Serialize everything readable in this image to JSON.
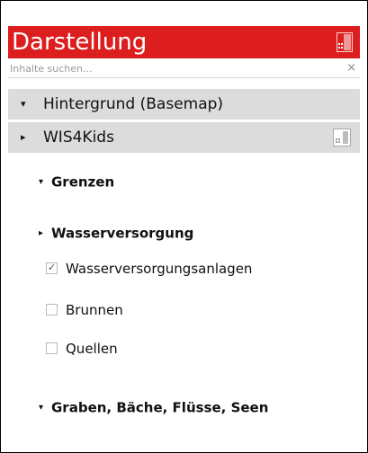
{
  "panel": {
    "title": "Darstellung",
    "accent_color": "#dc1e1e",
    "header_icon": "legend-icon"
  },
  "search": {
    "placeholder": "Inhalte suchen...",
    "value": "",
    "clear_label": "×"
  },
  "groups": [
    {
      "label": "Hintergrund (Basemap)",
      "expanded": true
    },
    {
      "label": "WIS4Kids",
      "expanded": false,
      "icon": "legend-icon"
    }
  ],
  "subgroups": [
    {
      "label": "Grenzen",
      "expanded": true
    },
    {
      "label": "Wasserversorgung",
      "expanded": false
    },
    {
      "label": "Graben, Bäche, Flüsse, Seen",
      "expanded": true
    }
  ],
  "layers": [
    {
      "label": "Wasserversorgungsanlagen",
      "checked": true
    },
    {
      "label": "Brunnen",
      "checked": false
    },
    {
      "label": "Quellen",
      "checked": false
    }
  ],
  "glyphs": {
    "expanded": "▾",
    "collapsed": "▸",
    "check": "✓"
  }
}
